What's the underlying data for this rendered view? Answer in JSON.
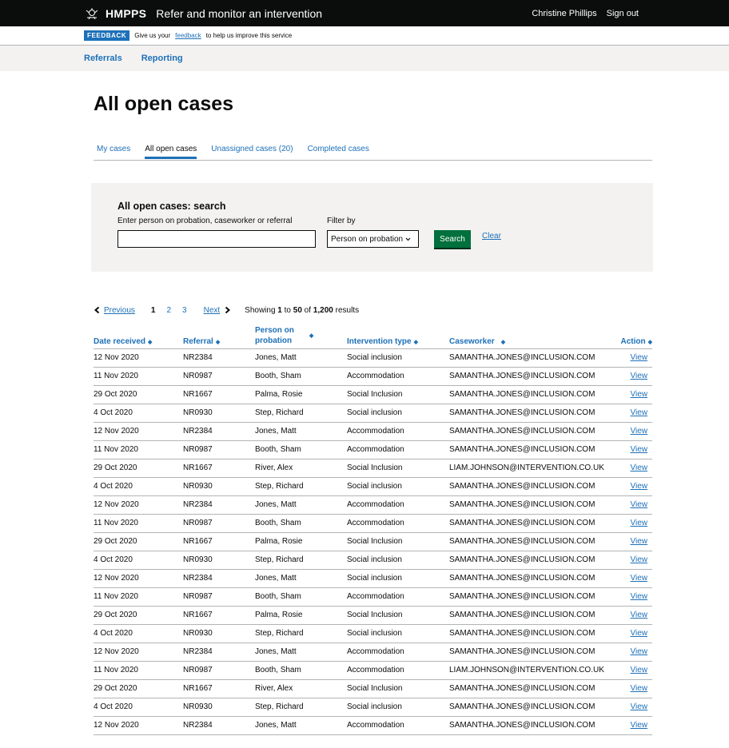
{
  "header": {
    "brand": "HMPPS",
    "service": "Refer and monitor an intervention",
    "user": "Christine Phillips",
    "sign_out": "Sign out"
  },
  "phase": {
    "tag": "FEEDBACK",
    "text_before": "Give us your",
    "link": "feedback",
    "text_after": "to help us improve this service"
  },
  "nav": {
    "referrals": "Referrals",
    "reporting": "Reporting"
  },
  "page": {
    "title": "All open cases"
  },
  "tabs": [
    {
      "label": "My cases"
    },
    {
      "label": "All open cases"
    },
    {
      "label": "Unassigned cases (20)"
    },
    {
      "label": "Completed cases"
    }
  ],
  "search": {
    "title": "All open cases: search",
    "label": "Enter person on probation, caseworker or referral",
    "value": "",
    "filter_label": "Filter by",
    "filter_value": "Person on probation",
    "button": "Search",
    "clear": "Clear"
  },
  "pager": {
    "previous": "Previous",
    "pages": [
      "1",
      "2",
      "3"
    ],
    "next": "Next",
    "showing_pre": "Showing",
    "from": "1",
    "to_word": "to",
    "to": "50",
    "of_word": "of",
    "total": "1,200",
    "results": "results"
  },
  "table": {
    "headers": {
      "date": "Date received",
      "referral": "Referral",
      "person_1": "Person on",
      "person_2": "probation",
      "type": "Intervention type",
      "caseworker": "Caseworker",
      "action": "Action"
    },
    "rows": [
      {
        "date": "12 Nov 2020",
        "ref": "NR2384",
        "person": "Jones, Matt",
        "type": "Social inclusion",
        "worker": "SAMANTHA.JONES@INCLUSION.COM",
        "action": "View"
      },
      {
        "date": "11 Nov 2020",
        "ref": "NR0987",
        "person": "Booth, Sham",
        "type": "Accommodation",
        "worker": "SAMANTHA.JONES@INCLUSION.COM",
        "action": "View"
      },
      {
        "date": "29 Oct 2020",
        "ref": "NR1667",
        "person": "Palma, Rosie",
        "type": "Social Inclusion",
        "worker": "SAMANTHA.JONES@INCLUSION.COM",
        "action": "View"
      },
      {
        "date": "4 Oct 2020",
        "ref": "NR0930",
        "person": "Step, Richard",
        "type": "Social inclusion",
        "worker": "SAMANTHA.JONES@INCLUSION.COM",
        "action": "View"
      },
      {
        "date": "12 Nov 2020",
        "ref": "NR2384",
        "person": "Jones, Matt",
        "type": "Accommodation",
        "worker": "SAMANTHA.JONES@INCLUSION.COM",
        "action": "View"
      },
      {
        "date": "11 Nov 2020",
        "ref": "NR0987",
        "person": "Booth, Sham",
        "type": "Accommodation",
        "worker": "SAMANTHA.JONES@INCLUSION.COM",
        "action": "View"
      },
      {
        "date": "29 Oct 2020",
        "ref": "NR1667",
        "person": "River, Alex",
        "type": "Social Inclusion",
        "worker": "LIAM.JOHNSON@INTERVENTION.CO.UK",
        "action": "View"
      },
      {
        "date": "4 Oct 2020",
        "ref": "NR0930",
        "person": "Step, Richard",
        "type": "Social inclusion",
        "worker": "SAMANTHA.JONES@INCLUSION.COM",
        "action": "View"
      },
      {
        "date": "12 Nov 2020",
        "ref": "NR2384",
        "person": "Jones, Matt",
        "type": "Accommodation",
        "worker": "SAMANTHA.JONES@INCLUSION.COM",
        "action": "View"
      },
      {
        "date": "11 Nov 2020",
        "ref": "NR0987",
        "person": "Booth, Sham",
        "type": "Accommodation",
        "worker": "SAMANTHA.JONES@INCLUSION.COM",
        "action": "View"
      },
      {
        "date": "29 Oct 2020",
        "ref": "NR1667",
        "person": "Palma, Rosie",
        "type": "Social Inclusion",
        "worker": "SAMANTHA.JONES@INCLUSION.COM",
        "action": "View"
      },
      {
        "date": "4 Oct 2020",
        "ref": "NR0930",
        "person": "Step, Richard",
        "type": "Social inclusion",
        "worker": "SAMANTHA.JONES@INCLUSION.COM",
        "action": "View"
      },
      {
        "date": "12 Nov 2020",
        "ref": "NR2384",
        "person": "Jones, Matt",
        "type": "Social inclusion",
        "worker": "SAMANTHA.JONES@INCLUSION.COM",
        "action": "View"
      },
      {
        "date": "11 Nov 2020",
        "ref": "NR0987",
        "person": "Booth, Sham",
        "type": "Accommodation",
        "worker": "SAMANTHA.JONES@INCLUSION.COM",
        "action": "View"
      },
      {
        "date": "29 Oct 2020",
        "ref": "NR1667",
        "person": "Palma, Rosie",
        "type": "Social Inclusion",
        "worker": "SAMANTHA.JONES@INCLUSION.COM",
        "action": "View"
      },
      {
        "date": "4 Oct 2020",
        "ref": "NR0930",
        "person": "Step, Richard",
        "type": "Social inclusion",
        "worker": "SAMANTHA.JONES@INCLUSION.COM",
        "action": "View"
      },
      {
        "date": "12 Nov 2020",
        "ref": "NR2384",
        "person": "Jones, Matt",
        "type": "Accommodation",
        "worker": "SAMANTHA.JONES@INCLUSION.COM",
        "action": "View"
      },
      {
        "date": "11 Nov 2020",
        "ref": "NR0987",
        "person": "Booth, Sham",
        "type": "Accommodation",
        "worker": "LIAM.JOHNSON@INTERVENTION.CO.UK",
        "action": "View"
      },
      {
        "date": "29 Oct 2020",
        "ref": "NR1667",
        "person": "River, Alex",
        "type": "Social Inclusion",
        "worker": "SAMANTHA.JONES@INCLUSION.COM",
        "action": "View"
      },
      {
        "date": "4 Oct 2020",
        "ref": "NR0930",
        "person": "Step, Richard",
        "type": "Social inclusion",
        "worker": "SAMANTHA.JONES@INCLUSION.COM",
        "action": "View"
      },
      {
        "date": "12 Nov 2020",
        "ref": "NR2384",
        "person": "Jones, Matt",
        "type": "Accommodation",
        "worker": "SAMANTHA.JONES@INCLUSION.COM",
        "action": "View"
      }
    ]
  },
  "colors": {
    "black": "#0b0c0c",
    "link": "#1d70b8",
    "button": "#00703c",
    "panel": "#f3f2f1"
  },
  "icons": [
    "crest-icon",
    "chevron-down-icon",
    "chevron-left-icon",
    "chevron-right-icon",
    "sort-icon"
  ]
}
